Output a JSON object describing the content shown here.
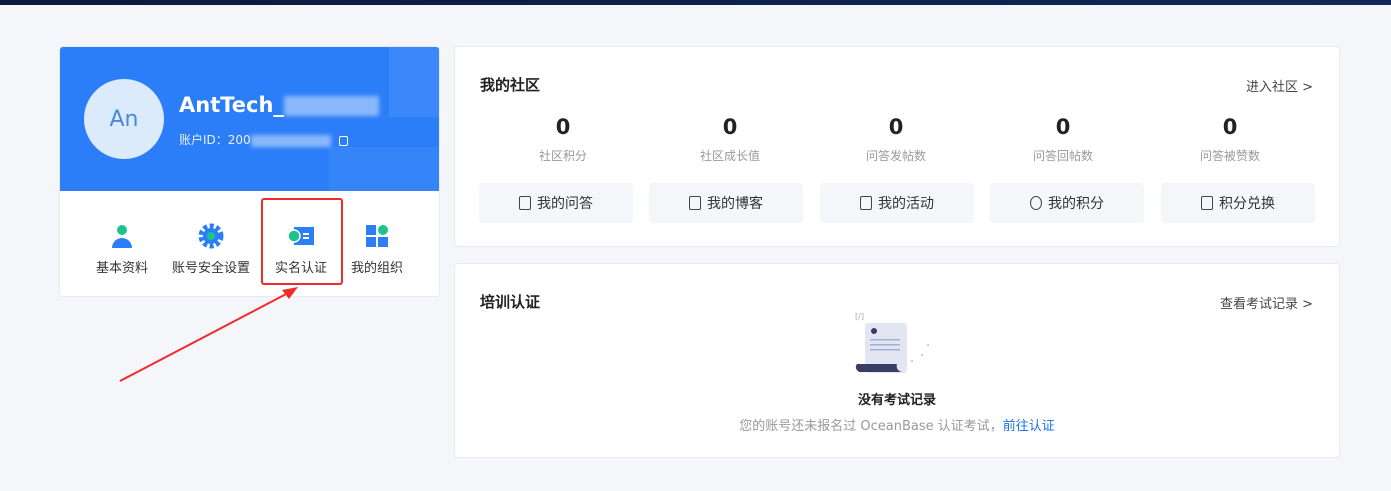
{
  "profile": {
    "avatar_text": "An",
    "username": "AntTech_",
    "account_label": "账户ID：",
    "account_id": "200",
    "actions": [
      {
        "label": "基本资料",
        "icon": "user-icon"
      },
      {
        "label": "账号安全设置",
        "icon": "gear-icon"
      },
      {
        "label": "实名认证",
        "icon": "id-card-icon"
      },
      {
        "label": "我的组织",
        "icon": "grid-icon"
      }
    ]
  },
  "community": {
    "title": "我的社区",
    "link": "进入社区 >",
    "stats": [
      {
        "value": "0",
        "label": "社区积分"
      },
      {
        "value": "0",
        "label": "社区成长值"
      },
      {
        "value": "0",
        "label": "问答发帖数"
      },
      {
        "value": "0",
        "label": "问答回帖数"
      },
      {
        "value": "0",
        "label": "问答被赞数"
      }
    ],
    "buttons": [
      {
        "label": "我的问答",
        "icon": "question-icon"
      },
      {
        "label": "我的博客",
        "icon": "document-icon"
      },
      {
        "label": "我的活动",
        "icon": "badge-icon"
      },
      {
        "label": "我的积分",
        "icon": "coins-icon"
      },
      {
        "label": "积分兑换",
        "icon": "store-icon"
      }
    ]
  },
  "training": {
    "title": "培训认证",
    "link": "查看考试记录 >",
    "empty_title": "没有考试记录",
    "empty_desc": "您的账号还未报名过 OceanBase 认证考试，",
    "empty_link": "前往认证"
  },
  "colors": {
    "brand": "#2b7ef8",
    "green": "#1ec28b",
    "highlight": "#f02b2b",
    "link": "#1a73e8"
  }
}
